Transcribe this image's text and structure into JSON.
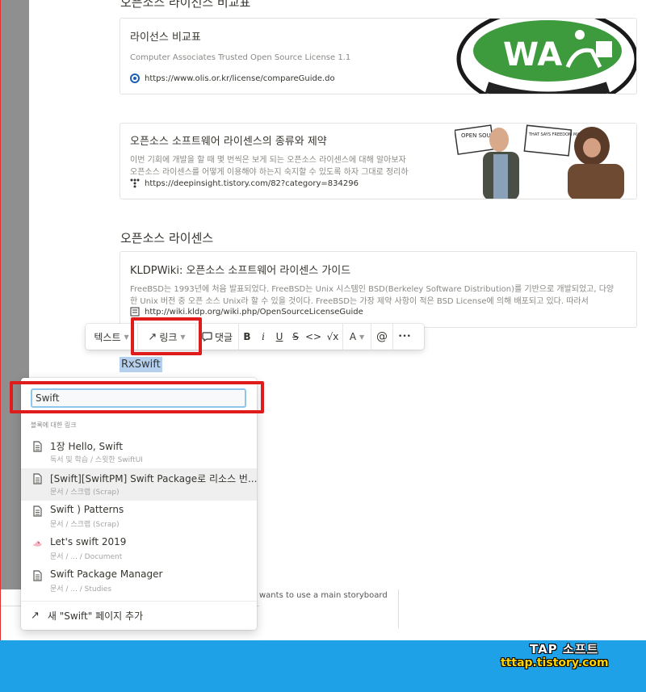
{
  "doc": {
    "top_section_title": "오픈소스 라이선스 비교표",
    "bookmarks": [
      {
        "title": "라이선스 비교표",
        "desc": "Computer Associates Trusted Open Source License 1.1",
        "url": "https://www.olis.or.kr/license/compareGuide.do",
        "thumb_text": "WA"
      },
      {
        "title": "오픈소스 소프트웨어 라이센스의 종류와 제약",
        "desc1": "이번 기회에 개발을 할 때 몇 번씩은 보게 되는 오픈소스 라이센스에 대해 알아보자",
        "desc2": "오픈소스 라이센스를 어떻게 이용해야 하는지 숙지할 수 있도록 하자 그대로 정리하",
        "url": "https://deepinsight.tistory.com/82?category=834296",
        "sign1": "OPEN SOURCE",
        "sign2": "THAT SAYS FREEDOM MATTERS"
      }
    ],
    "section2_title": "오픈소스 라이센스",
    "bookmark3": {
      "title": "KLDPWiki: 오픈소스 소프트웨어 라이센스 가이드",
      "desc1": "FreeBSD는 1993년에 처음 발표되었다. FreeBSD는 Unix 시스템인 BSD(Berkeley Software Distribution)를 기반으로 개발되었고, 다양",
      "desc2": "한 Unix 버전 중 오픈 소스 Unix라 할 수 있을 것이다. FreeBSD는 가장 제약 사항이 적은 BSD License에 의해 배포되고 있다. 따라서",
      "url": "http://wiki.kldp.org/wiki.php/OpenSourceLicenseGuide"
    },
    "selected_text": "RxSwift",
    "behind_text": "wants to use a main storyboard"
  },
  "toolbar": {
    "text_label": "텍스트",
    "link_label": "링크",
    "comment_label": "댓글",
    "bold": "B",
    "italic": "i",
    "underline": "U",
    "strike": "S",
    "code": "<>",
    "math": "√x",
    "color": "A",
    "mention": "@",
    "more": "•••"
  },
  "link_popup": {
    "search_value": "Swift",
    "section_header": "블록에 대한 링크",
    "items": [
      {
        "title": "1장 Hello, Swift",
        "sub": "독서 및 학습 / 스윗한 SwiftUI",
        "icon": "page-icon"
      },
      {
        "title": "[Swift][SwiftPM] Swift Package로 리소스 번...",
        "sub": "문서 / 스크랩 (Scrap)",
        "icon": "page-icon"
      },
      {
        "title": "Swift ) Patterns",
        "sub": "문서 / 스크랩 (Scrap)",
        "icon": "page-icon"
      },
      {
        "title": "Let's swift 2019",
        "sub": "문서 / ... / Document",
        "icon": "emoji-icon"
      },
      {
        "title": "Swift Package Manager",
        "sub": "문서 / ... / Studies",
        "icon": "page-icon"
      }
    ],
    "add_page_label": "새 \"Swift\" 페이지 추가"
  },
  "footer": {
    "brand_line1": "TAP 소프트",
    "brand_line2": "tttap.tistory.com"
  },
  "colors": {
    "highlight_red": "#e01b1b",
    "selection_blue": "#b4d0ee",
    "footer_blue": "#1ea1e6"
  }
}
